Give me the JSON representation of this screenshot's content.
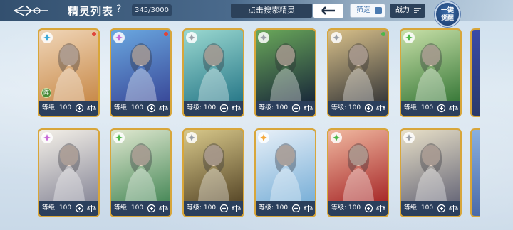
{
  "header": {
    "back_icon": "back-arrow-icon",
    "title": "精灵列表",
    "help": "?",
    "count": "345/3000",
    "search_placeholder": "点击搜索精灵",
    "filter_label": "筛选",
    "power_label": "战力",
    "awaken_label_1": "一键",
    "awaken_label_2": "觉醒"
  },
  "cards": [
    {
      "level": "等级: 100",
      "element_color": "#3aa8d8",
      "corner": "#e0443a",
      "tag": "阵",
      "bg": [
        "#f0d6b8",
        "#c88a4a"
      ]
    },
    {
      "level": "等级: 100",
      "element_color": "#c86ad8",
      "corner": "#e0443a",
      "tag": "",
      "bg": [
        "#6aa8e0",
        "#3a4a9a"
      ]
    },
    {
      "level": "等级: 100",
      "element_color": "#9aa0a8",
      "corner": "",
      "tag": "",
      "bg": [
        "#9ad8d0",
        "#2a7a8a"
      ]
    },
    {
      "level": "等级: 100",
      "element_color": "#9aa0a8",
      "corner": "",
      "tag": "",
      "bg": [
        "#6aa85a",
        "#1a2a3a"
      ]
    },
    {
      "level": "等级: 100",
      "element_color": "#9aa0a8",
      "corner": "#4ab84a",
      "tag": "",
      "bg": [
        "#d8c08a",
        "#3a3a3a"
      ]
    },
    {
      "level": "等级: 100",
      "element_color": "#4ab84a",
      "corner": "",
      "tag": "",
      "bg": [
        "#c8e0a8",
        "#3a7a3a"
      ]
    },
    {
      "level": "等级: 100",
      "element_color": "#c86ad8",
      "corner": "",
      "tag": "",
      "bg": [
        "#f4f0e8",
        "#8a8a9a"
      ]
    },
    {
      "level": "等级: 100",
      "element_color": "#4ab84a",
      "corner": "",
      "tag": "",
      "bg": [
        "#e0e8d0",
        "#4a8a5a"
      ]
    },
    {
      "level": "等级: 100",
      "element_color": "#9aa0a8",
      "corner": "",
      "tag": "",
      "bg": [
        "#d8c88a",
        "#5a4a2a"
      ]
    },
    {
      "level": "等级: 100",
      "element_color": "#f4a83a",
      "corner": "",
      "tag": "",
      "bg": [
        "#e8f0f8",
        "#7ab0d8"
      ]
    },
    {
      "level": "等级: 100",
      "element_color": "#4ab84a",
      "corner": "",
      "tag": "",
      "bg": [
        "#f0b8a0",
        "#a82a2a"
      ]
    },
    {
      "level": "等级: 100",
      "element_color": "#9aa0a8",
      "corner": "",
      "tag": "",
      "bg": [
        "#e8e0c8",
        "#6a6a7a"
      ]
    }
  ]
}
